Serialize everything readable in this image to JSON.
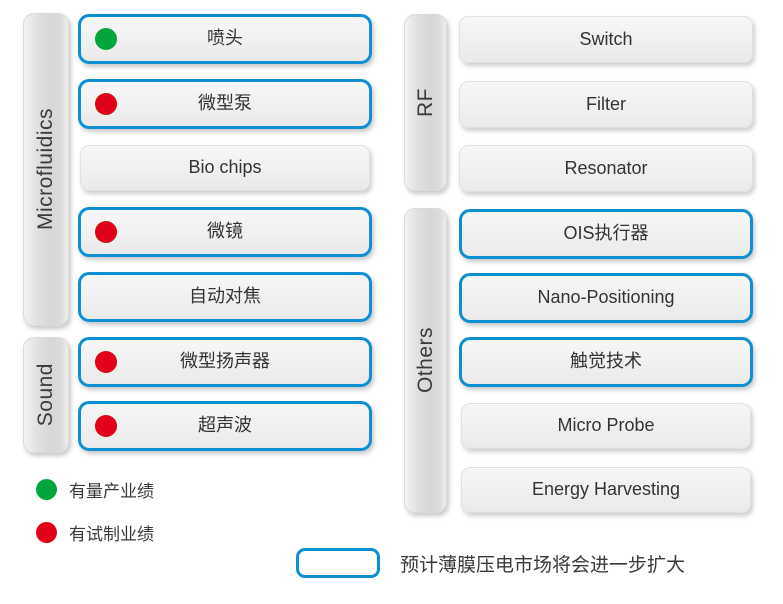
{
  "colors": {
    "highlight_border": "#0d8fd4",
    "dot_green": "#00a63c",
    "dot_red": "#e00018",
    "pill_bg": "#f1f1f1",
    "strip_bg": "#d9d9d9",
    "text": "#333333"
  },
  "categories": [
    {
      "key": "microfluidics",
      "label": "Microfluidics",
      "items": [
        {
          "label": "喷头",
          "highlighted": true,
          "marker": "green"
        },
        {
          "label": "微型泵",
          "highlighted": true,
          "marker": "red"
        },
        {
          "label": "Bio chips",
          "highlighted": false,
          "marker": "none"
        },
        {
          "label": "微镜",
          "highlighted": true,
          "marker": "red"
        },
        {
          "label": "自动对焦",
          "highlighted": true,
          "marker": "none"
        }
      ]
    },
    {
      "key": "sound",
      "label": "Sound",
      "items": [
        {
          "label": "微型扬声器",
          "highlighted": true,
          "marker": "red"
        },
        {
          "label": "超声波",
          "highlighted": true,
          "marker": "red"
        }
      ]
    },
    {
      "key": "rf",
      "label": "RF",
      "items": [
        {
          "label": "Switch",
          "highlighted": false,
          "marker": "none"
        },
        {
          "label": "Filter",
          "highlighted": false,
          "marker": "none"
        },
        {
          "label": "Resonator",
          "highlighted": false,
          "marker": "none"
        }
      ]
    },
    {
      "key": "others",
      "label": "Others",
      "items": [
        {
          "label": "OIS执行器",
          "highlighted": true,
          "marker": "none"
        },
        {
          "label": "Nano-Positioning",
          "highlighted": true,
          "marker": "none"
        },
        {
          "label": "触觉技术",
          "highlighted": true,
          "marker": "none"
        },
        {
          "label": "Micro Probe",
          "highlighted": false,
          "marker": "none"
        },
        {
          "label": "Energy Harvesting",
          "highlighted": false,
          "marker": "none"
        }
      ]
    }
  ],
  "legend": {
    "items": [
      {
        "marker": "green",
        "label": "有量产业绩"
      },
      {
        "marker": "red",
        "label": "有试制业绩"
      }
    ]
  },
  "note": {
    "swatch": "highlighted-box",
    "label": "预计薄膜压电市场将会进一步扩大"
  }
}
